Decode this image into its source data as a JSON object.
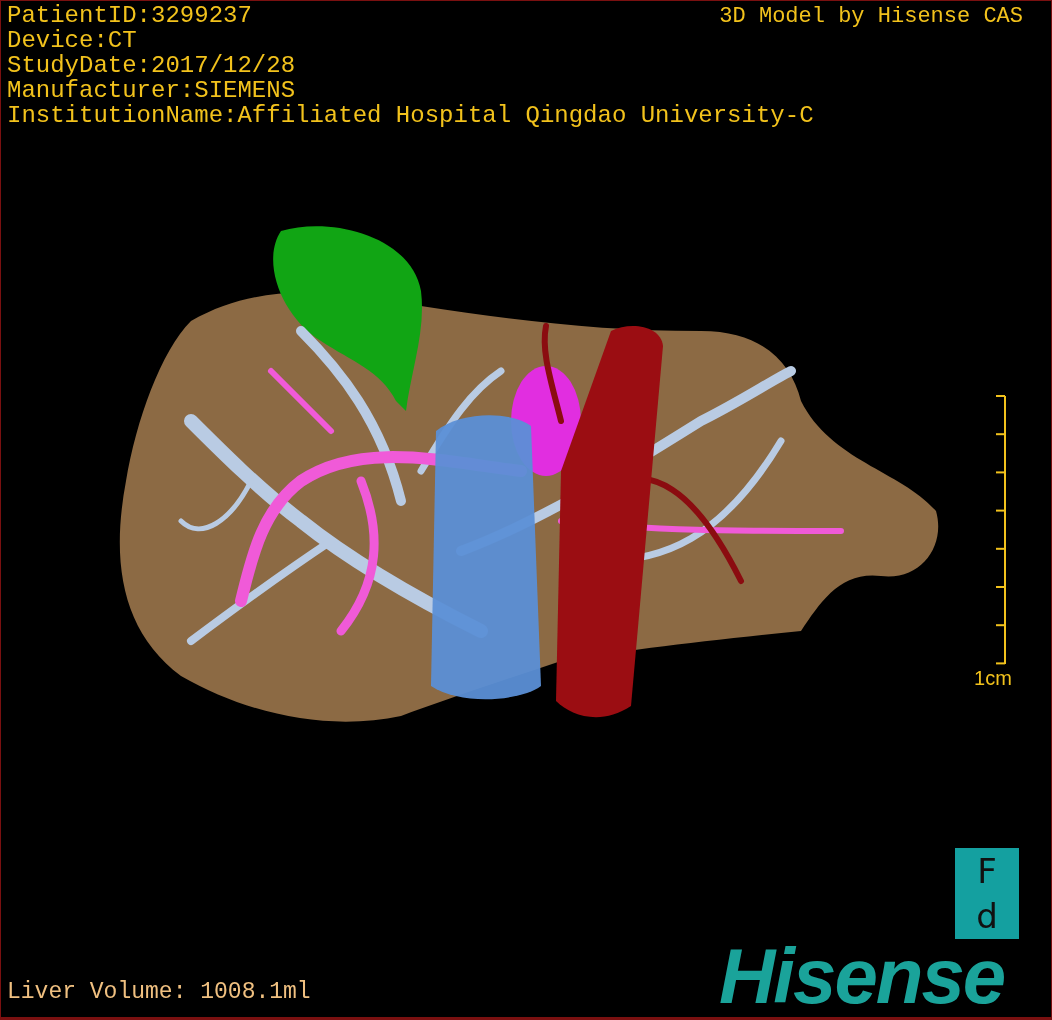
{
  "patient_info": [
    "PatientID:3299237",
    "Device:CT",
    "StudyDate:2017/12/28",
    "Manufacturer:SIEMENS",
    "InstitutionName:Affiliated Hospital Qingdao University-C"
  ],
  "credit": "3D Model by Hisense CAS",
  "scale_bar": {
    "label": "1cm"
  },
  "liver_volume": "Liver Volume: 1008.1ml",
  "orientation_marker": {
    "top": "F",
    "bottom": "d"
  },
  "logo": "Hisense"
}
